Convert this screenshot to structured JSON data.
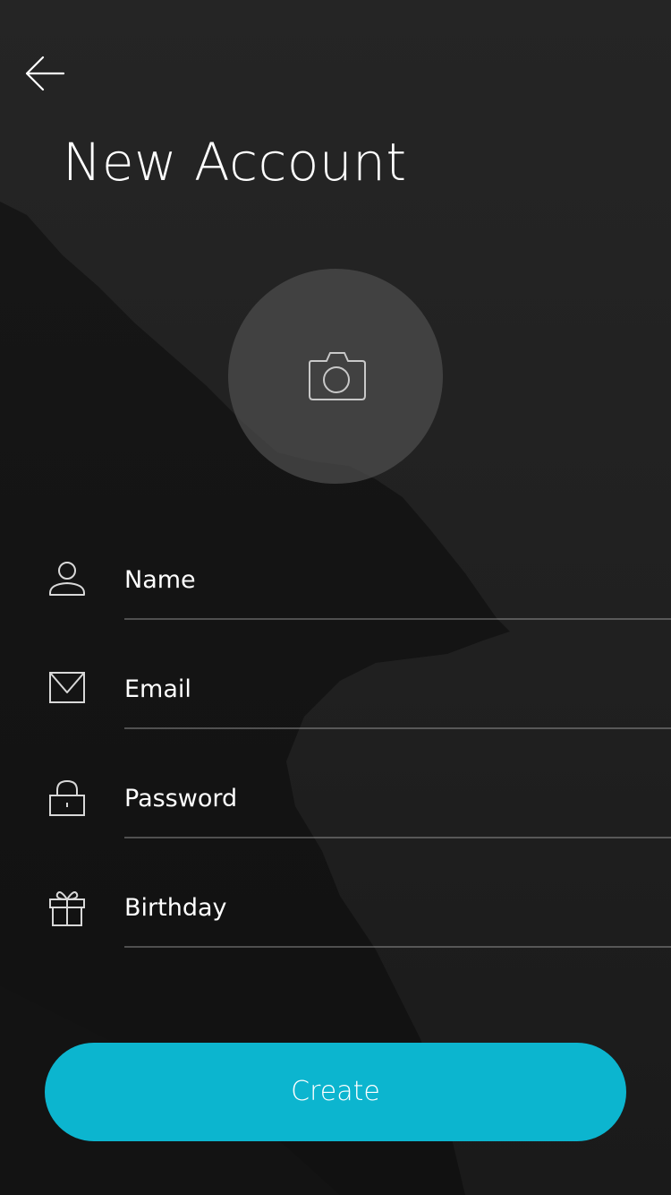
{
  "header": {
    "back_icon": "arrow-left-icon",
    "title": "New Account"
  },
  "avatar": {
    "icon": "camera-icon"
  },
  "form": {
    "fields": [
      {
        "icon": "user-icon",
        "placeholder": "Name",
        "value": ""
      },
      {
        "icon": "envelope-icon",
        "placeholder": "Email",
        "value": ""
      },
      {
        "icon": "lock-icon",
        "placeholder": "Password",
        "value": ""
      },
      {
        "icon": "gift-icon",
        "placeholder": "Birthday",
        "value": ""
      }
    ]
  },
  "actions": {
    "create_label": "Create"
  },
  "colors": {
    "accent": "#0CB5CF",
    "background": "#1F1F1F",
    "text": "#FFFFFF"
  }
}
